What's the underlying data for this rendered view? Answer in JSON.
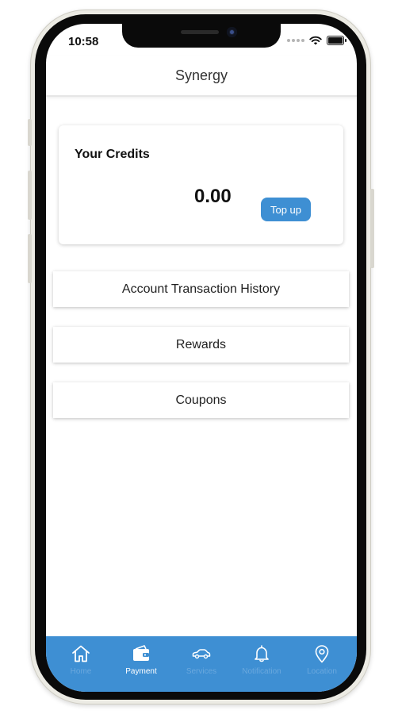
{
  "status_bar": {
    "time": "10:58"
  },
  "header": {
    "title": "Synergy"
  },
  "credits": {
    "title": "Your Credits",
    "amount": "0.00",
    "topup_label": "Top up"
  },
  "menu": {
    "items": [
      {
        "label": "Account Transaction History"
      },
      {
        "label": "Rewards"
      },
      {
        "label": "Coupons"
      }
    ]
  },
  "tab_bar": {
    "items": [
      {
        "label": "Home",
        "icon": "home-icon",
        "active": false
      },
      {
        "label": "Payment",
        "icon": "wallet-icon",
        "active": true
      },
      {
        "label": "Services",
        "icon": "car-icon",
        "active": false
      },
      {
        "label": "Notification",
        "icon": "bell-icon",
        "active": false
      },
      {
        "label": "Location",
        "icon": "location-pin-icon",
        "active": false
      }
    ]
  },
  "colors": {
    "accent": "#3e8fd3",
    "tab_inactive": "#6aa8de",
    "tab_active": "#ffffff"
  }
}
